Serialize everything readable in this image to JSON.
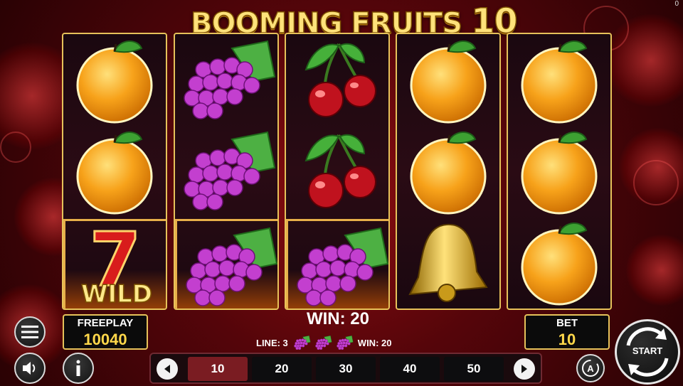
{
  "game": {
    "title_main": "BOOMING FRUITS",
    "title_num": "10",
    "corner_value": "0"
  },
  "reels": [
    [
      "orange",
      "orange",
      "wild"
    ],
    [
      "grapes",
      "grapes",
      "grapes"
    ],
    [
      "cherries",
      "cherries",
      "grapes"
    ],
    [
      "orange",
      "orange",
      "bell"
    ],
    [
      "orange",
      "orange",
      "orange"
    ]
  ],
  "wild_symbol": {
    "seven": "7",
    "text": "WILD"
  },
  "freeplay": {
    "label": "FREEPLAY",
    "value": "10040"
  },
  "bet": {
    "label": "BET",
    "value": "10"
  },
  "win": {
    "text": "WIN: 20"
  },
  "line_info": {
    "line_text": "LINE: 3",
    "symbol": "grapes",
    "symbol_count": 3,
    "win_text": "WIN: 20"
  },
  "bet_options": [
    "10",
    "20",
    "30",
    "40",
    "50"
  ],
  "bet_selected": "10",
  "buttons": {
    "start_label": "START",
    "auto_label": "A"
  },
  "colors": {
    "gold_frame": "#e6c25a",
    "value_yellow": "#ffd84a",
    "selected_bet": "#7a1c22"
  }
}
